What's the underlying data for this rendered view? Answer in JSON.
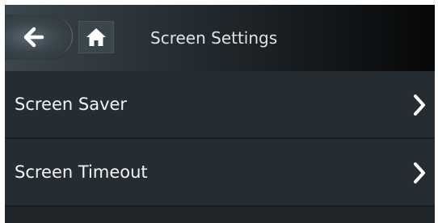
{
  "header": {
    "title": "Screen Settings",
    "back_icon": "back-arrow-icon",
    "home_icon": "home-icon"
  },
  "menu": {
    "items": [
      {
        "label": "Screen Saver",
        "icon": "chevron-right-icon"
      },
      {
        "label": "Screen Timeout",
        "icon": "chevron-right-icon"
      }
    ]
  },
  "colors": {
    "background": "#1f2529",
    "row": "#262d32",
    "text": "#f2f4f5",
    "accent_button": "#3a454c"
  }
}
